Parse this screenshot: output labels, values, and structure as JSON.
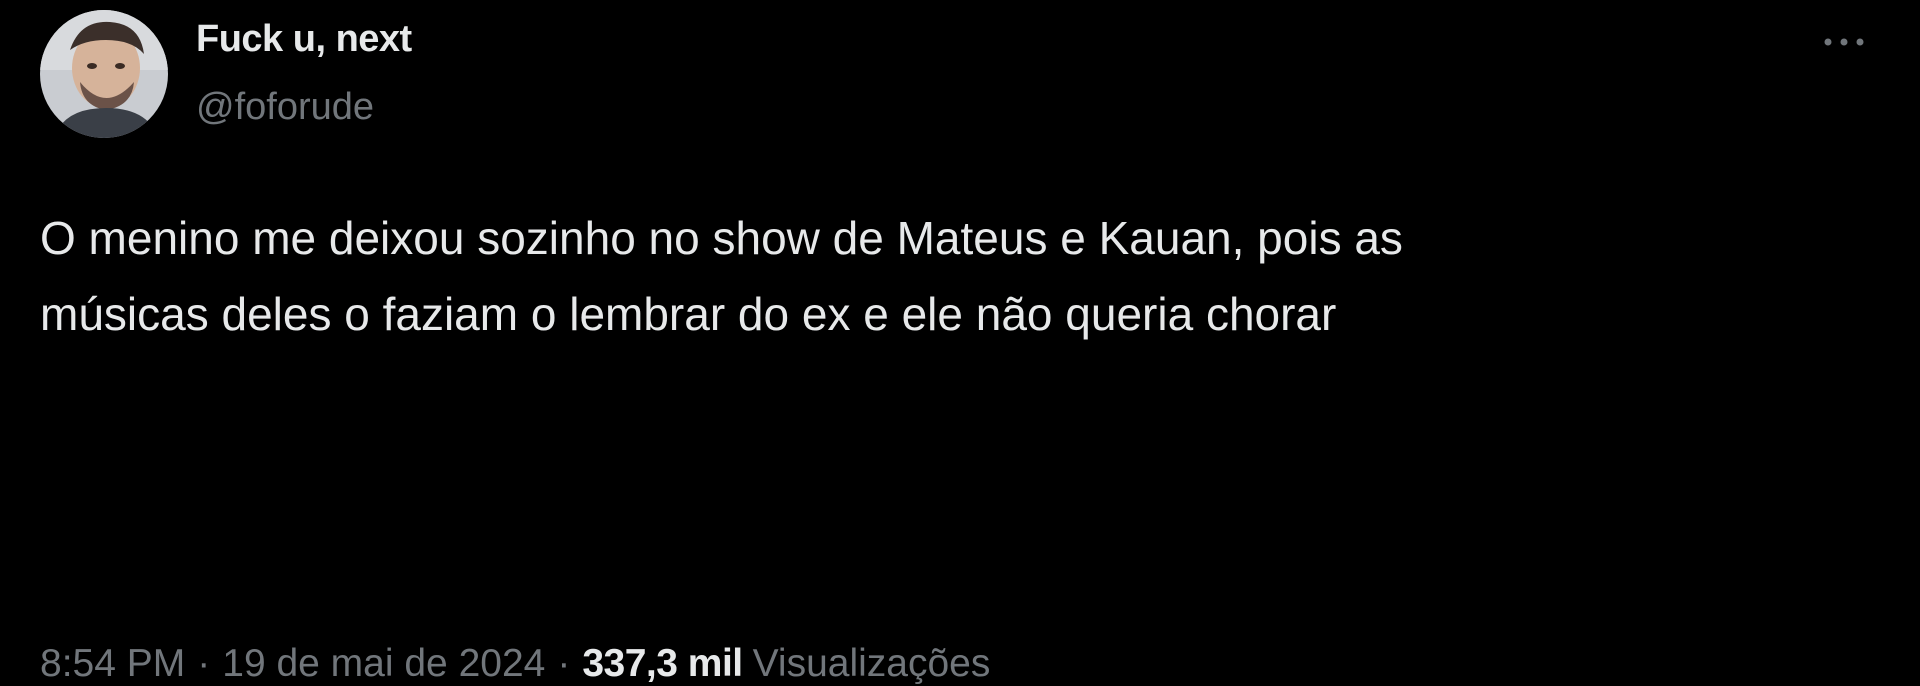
{
  "author": {
    "display_name": "Fuck u, next",
    "handle": "@foforude"
  },
  "tweet": {
    "text": "O menino me deixou sozinho no show de Mateus e Kauan, pois as\nmúsicas deles o faziam o lembrar do ex e ele não queria chorar"
  },
  "meta": {
    "time": "8:54 PM",
    "separator": "·",
    "date": "19 de mai de 2024",
    "views_count": "337,3 mil",
    "views_label": "Visualizações"
  },
  "icons": {
    "more": "more-horizontal-icon"
  },
  "colors": {
    "background": "#000000",
    "primary_text": "#e7e9ea",
    "secondary_text": "#71767b"
  }
}
